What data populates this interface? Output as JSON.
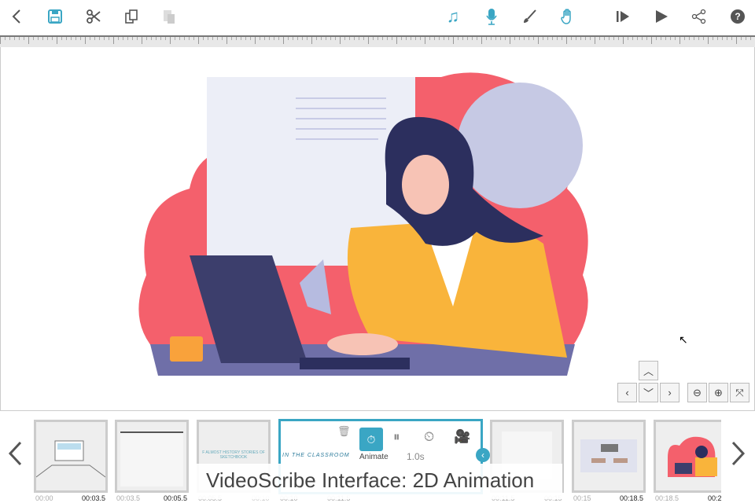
{
  "toolbar": {
    "left": [
      "back",
      "save",
      "cut",
      "copy",
      "paste"
    ],
    "right": [
      "music",
      "microphone",
      "brush",
      "hand",
      "play-from",
      "play",
      "share",
      "help"
    ],
    "help_label": "?"
  },
  "timeline": {
    "thumbnails": [
      {
        "start": "00:00",
        "end": "00:03.5"
      },
      {
        "start": "00:03.5",
        "end": "00:05.5"
      },
      {
        "start": "00:05.5",
        "end": "00:10",
        "text": "F ALMOST HISTORY STORIES OF SKETCHBOOK"
      },
      {
        "start": "00:10",
        "end": "00:11.5",
        "text": "IN THE CLASSROOM"
      },
      {
        "start": "00:11.5",
        "end": "00:15"
      },
      {
        "start": "00:15",
        "end": "00:18.5"
      },
      {
        "start": "00:18.5",
        "end": "00:2"
      }
    ],
    "selected": {
      "animate_label": "Animate",
      "duration": "1.0s"
    }
  },
  "caption": "VideoScribe Interface: 2D Animation",
  "colors": {
    "accent": "#3aa6c4",
    "coral": "#f4606c",
    "yellow": "#f9b43b",
    "navy": "#2c2f5e"
  }
}
